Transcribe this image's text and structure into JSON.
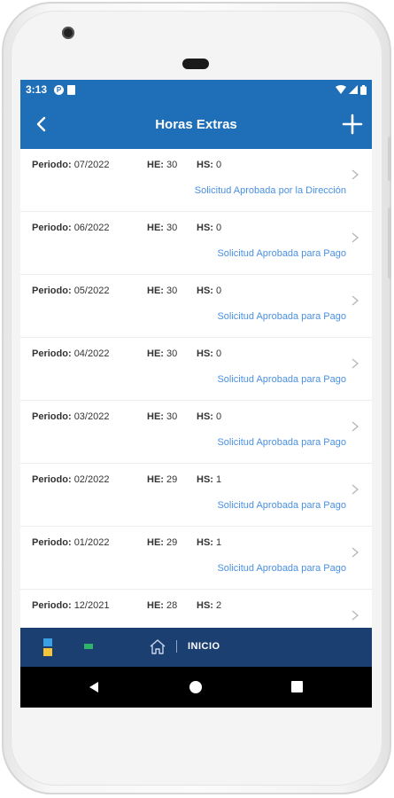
{
  "status_bar": {
    "time": "3:13",
    "icons": [
      "p-badge-icon",
      "sim-card-icon",
      "wifi-icon",
      "signal-icon",
      "battery-icon"
    ]
  },
  "app_bar": {
    "title": "Horas Extras",
    "back_icon": "chevron-left-icon",
    "add_icon": "plus-icon"
  },
  "colors": {
    "app_bar": "#1f6fb8",
    "status_text": "#4a90e2",
    "bottom_nav": "#1c3f72"
  },
  "labels": {
    "periodo": "Periodo:",
    "he": "HE:",
    "hs": "HS:"
  },
  "items": [
    {
      "periodo": "07/2022",
      "he": "30",
      "hs": "0",
      "status": "Solicitud Aprobada por la Dirección"
    },
    {
      "periodo": "06/2022",
      "he": "30",
      "hs": "0",
      "status": "Solicitud Aprobada para Pago"
    },
    {
      "periodo": "05/2022",
      "he": "30",
      "hs": "0",
      "status": "Solicitud Aprobada para Pago"
    },
    {
      "periodo": "04/2022",
      "he": "30",
      "hs": "0",
      "status": "Solicitud Aprobada para Pago"
    },
    {
      "periodo": "03/2022",
      "he": "30",
      "hs": "0",
      "status": "Solicitud Aprobada para Pago"
    },
    {
      "periodo": "02/2022",
      "he": "29",
      "hs": "1",
      "status": "Solicitud Aprobada para Pago"
    },
    {
      "periodo": "01/2022",
      "he": "29",
      "hs": "1",
      "status": "Solicitud Aprobada para Pago"
    },
    {
      "periodo": "12/2021",
      "he": "28",
      "hs": "2",
      "status": ""
    }
  ],
  "bottom_nav": {
    "label": "INICIO"
  }
}
